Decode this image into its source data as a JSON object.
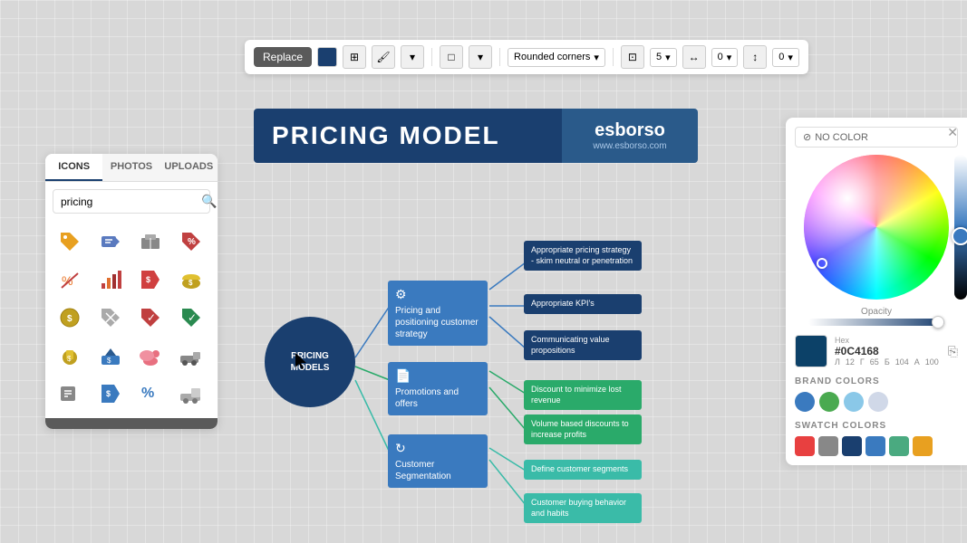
{
  "toolbar": {
    "replace_label": "Replace",
    "shape_select": "Rounded corners",
    "size_value": "5",
    "width_value": "0",
    "height_value": "0",
    "color": "#1a3f6f"
  },
  "left_panel": {
    "tabs": [
      "ICONS",
      "PHOTOS",
      "UPLOADS"
    ],
    "active_tab": "ICONS",
    "search_placeholder": "pricing",
    "icons": [
      {
        "name": "price-tag-icon",
        "color": "#e8a020",
        "shape": "tag"
      },
      {
        "name": "price-label-icon",
        "color": "#5a7abf",
        "shape": "label"
      },
      {
        "name": "cash-register-icon",
        "color": "#888",
        "shape": "register"
      },
      {
        "name": "price-cut-icon",
        "color": "#c04040",
        "shape": "cut"
      },
      {
        "name": "percent-icon",
        "color": "#e87020",
        "shape": "percent"
      },
      {
        "name": "chart-icon",
        "color": "#c04040",
        "shape": "chart"
      },
      {
        "name": "tag-sale-icon",
        "color": "#d04040",
        "shape": "tag2"
      },
      {
        "name": "money-bag-icon",
        "color": "#c0a020",
        "shape": "bag"
      },
      {
        "name": "coin-icon",
        "color": "#c0a020",
        "shape": "coin"
      },
      {
        "name": "price-badge-icon",
        "color": "#aaa",
        "shape": "badge"
      },
      {
        "name": "tag-x-icon",
        "color": "#c04040",
        "shape": "tagx"
      },
      {
        "name": "tag-check-icon",
        "color": "#2a8a50",
        "shape": "tagcheck"
      },
      {
        "name": "gold-coin-icon",
        "color": "#c0a020",
        "shape": "goldcoin"
      },
      {
        "name": "house-price-icon",
        "color": "#3a7abf",
        "shape": "house"
      },
      {
        "name": "piggy-icon",
        "color": "#e87080",
        "shape": "piggy"
      },
      {
        "name": "truck-icon",
        "color": "#888",
        "shape": "truck"
      },
      {
        "name": "receipt-icon",
        "color": "#888",
        "shape": "receipt"
      },
      {
        "name": "tag-2-icon",
        "color": "#3a7abf",
        "shape": "tag3"
      },
      {
        "name": "percent-2-icon",
        "color": "#3a7abf",
        "shape": "percent2"
      },
      {
        "name": "truck-2-icon",
        "color": "#aaa",
        "shape": "truck2"
      }
    ]
  },
  "main_canvas": {
    "header": {
      "title": "PRICING MODEL",
      "brand_name": "esborso",
      "brand_url": "www.esborso.com"
    },
    "center_node": {
      "label": "PRICING\nMODELS"
    },
    "branches": [
      {
        "id": "branch1",
        "icon": "⚙",
        "label": "Pricing and positioning\ncustomer strategy",
        "leaves": [
          {
            "label": "Appropriate pricing strategy - skim neutral or penetration",
            "color": "dark"
          },
          {
            "label": "Appropriate KPI's",
            "color": "dark"
          },
          {
            "label": "Communicating value propositions",
            "color": "dark"
          }
        ]
      },
      {
        "id": "branch2",
        "icon": "📄",
        "label": "Promotions and offers",
        "leaves": [
          {
            "label": "Discount to minimize lost revenue",
            "color": "green"
          },
          {
            "label": "Volume based discounts to increase profits",
            "color": "green"
          }
        ]
      },
      {
        "id": "branch3",
        "icon": "↻",
        "label": "Customer Segmentation",
        "leaves": [
          {
            "label": "Define customer segments",
            "color": "teal"
          },
          {
            "label": "Customer buying behavior and habits",
            "color": "teal"
          }
        ]
      }
    ]
  },
  "color_panel": {
    "no_color_label": "NO COLOR",
    "hex_label": "Hex",
    "hex_value": "#0C4168",
    "r_label": "Л",
    "r_value": "12",
    "g_label": "Г",
    "g_value": "65",
    "b_label": "Б",
    "b_value": "104",
    "a_label": "А",
    "a_value": "100",
    "opacity_label": "Opacity",
    "brand_colors_label": "BRAND COLORS",
    "brand_colors": [
      "#3a7abf",
      "#4aaa50",
      "#8ac8e8",
      "#d0d8e8"
    ],
    "swatch_colors_label": "SWATCH COLORS",
    "swatch_colors": [
      "#e84040",
      "#888",
      "#1a3f6f",
      "#3a7abf",
      "#4aaa80",
      "#e8a020"
    ]
  }
}
